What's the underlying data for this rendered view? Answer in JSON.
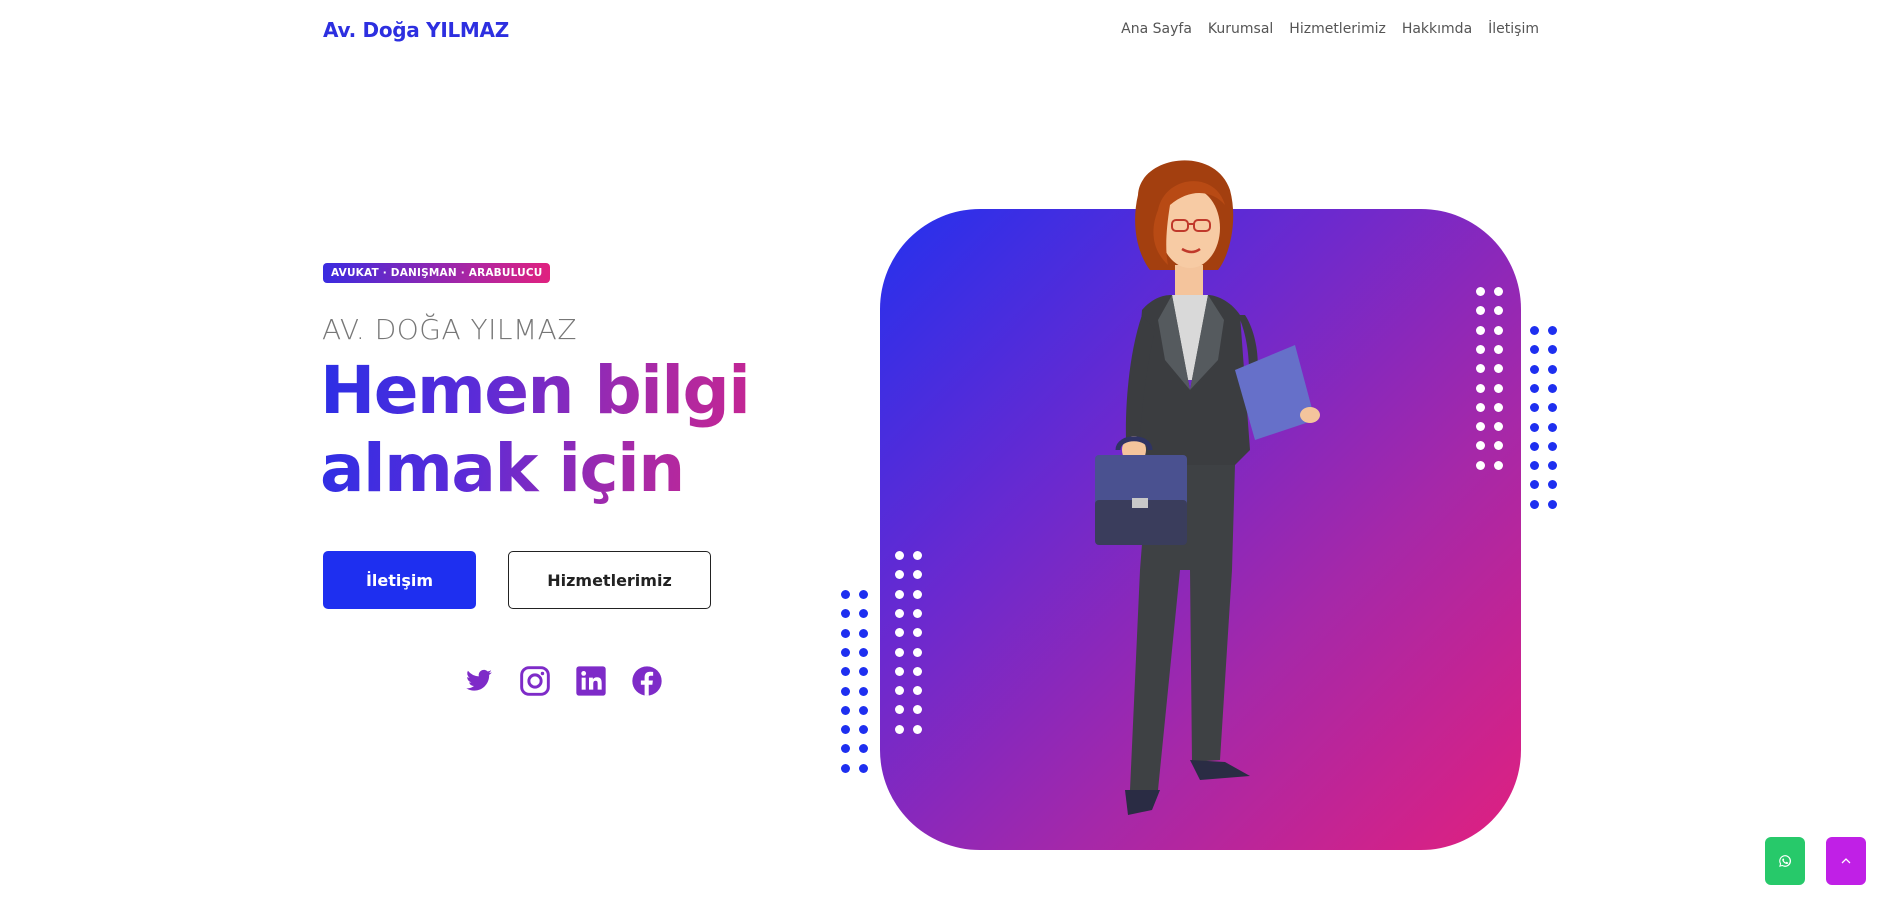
{
  "brand": "Av. Doğa YILMAZ",
  "nav": {
    "items": [
      "Ana Sayfa",
      "Kurumsal",
      "Hizmetlerimiz",
      "Hakkımda",
      "İletişim"
    ]
  },
  "hero": {
    "badge": "AVUKAT · DANIŞMAN · ARABULUCU",
    "subtitle": "AV. DOĞA YILMAZ",
    "headline_line1": "Hemen bilgi",
    "headline_line2": "almak için",
    "primary_button": "İletişim",
    "secondary_button": "Hizmetlerimiz"
  },
  "socials": [
    "twitter-icon",
    "instagram-icon",
    "linkedin-icon",
    "facebook-icon"
  ],
  "colors": {
    "brand_blue": "#2d2fe0",
    "primary_button": "#1e2ff0",
    "gradient_start": "#2431ee",
    "gradient_end": "#e0207f",
    "social_icon": "#7e2bc8",
    "whatsapp_fab": "#27c96a",
    "scroll_top_fab": "#c020e6"
  },
  "floating": {
    "whatsapp_icon": "whatsapp-icon",
    "scroll_top_icon": "chevron-up-icon"
  }
}
